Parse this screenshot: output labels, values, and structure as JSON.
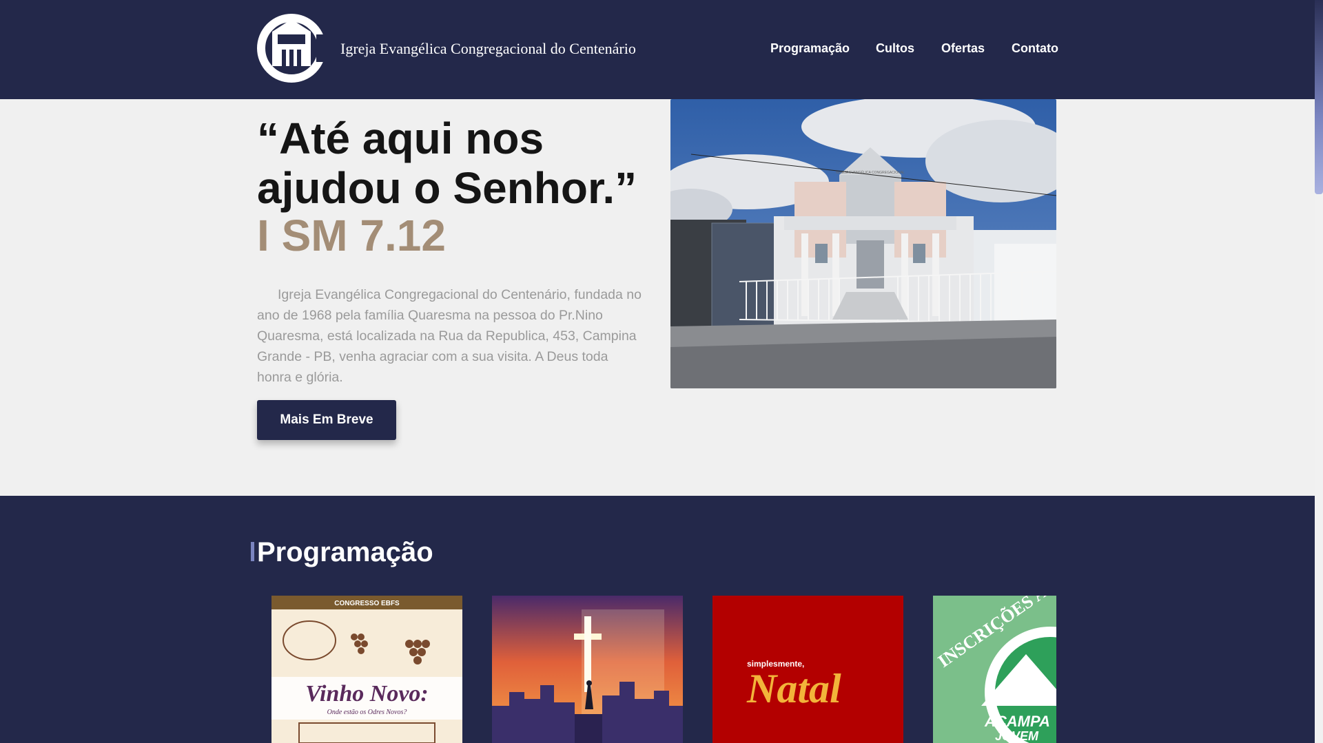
{
  "header": {
    "logo_icon": "church-logo-icon",
    "site_title": "Igreja Evangélica Congregacional do Centenário",
    "nav": [
      "Programação",
      "Cultos",
      "Ofertas",
      "Contato"
    ]
  },
  "hero": {
    "quote": "“Até aqui nos ajudou o Senhor.”",
    "verse": "I SM 7.12",
    "description": "Igreja Evangélica Congregacional do Centenário, fundada no ano de 1968 pela família Quaresma na pessoa do Pr.Nino Quaresma, está localizada na Rua da Republica, 453, Campina Grande - PB, venha agraciar com a sua visita. A Deus toda honra e glória.",
    "cta_label": "Mais Em Breve",
    "church_photo_sign": "IGREJA EVANGÉLICA CONGREGACIONAL"
  },
  "programacao": {
    "title": "Programação",
    "cards": [
      {
        "header": "CONGRESSO EBFS",
        "title": "Vinho Novo:",
        "subtitle": "Onde estão os Odres Novos?"
      },
      {
        "image": "cross-over-city-icon"
      },
      {
        "prefix": "simplesmente,",
        "title": "Natal"
      },
      {
        "title": "INSCRIÇÕES ABERTAS",
        "logo_line1": "ACAMPA",
        "logo_line2": "JOVEM"
      }
    ]
  },
  "colors": {
    "navy": "#23284a",
    "accent": "#a38d76",
    "scroll": "#7a84c0"
  }
}
